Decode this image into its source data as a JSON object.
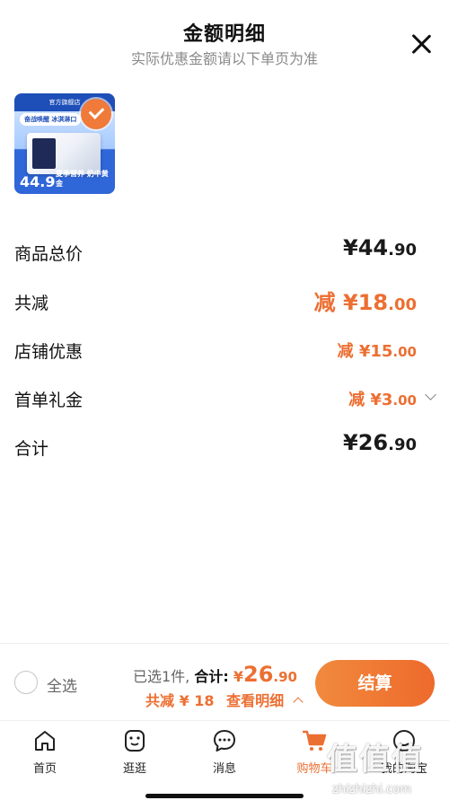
{
  "header": {
    "title": "金额明细",
    "subtitle": "实际优惠金额请以下单页为准"
  },
  "product": {
    "thumb_top_text": "官方旗舰店",
    "thumb_tag": "奋战唤醒 冰淇淋口",
    "thumb_price": "44.9",
    "thumb_slogan": "夏季营养 奶中黄金",
    "selected": true
  },
  "breakdown": [
    {
      "label": "商品总价",
      "prefix": "",
      "yen": "¥",
      "whole": "44",
      "cents": ".90"
    },
    {
      "label": "共减",
      "prefix": "减 ",
      "yen": "¥",
      "whole": "18",
      "cents": ".00"
    },
    {
      "label": "店铺优惠",
      "prefix": "减 ",
      "yen": "¥",
      "whole": "15",
      "cents": ".00"
    },
    {
      "label": "首单礼金",
      "prefix": "减 ",
      "yen": "¥",
      "whole": "3",
      "cents": ".00"
    },
    {
      "label": "合计",
      "prefix": "",
      "yen": "¥",
      "whole": "26",
      "cents": ".90"
    }
  ],
  "bottom_bar": {
    "select_all_label": "全选",
    "selected_count_text": "已选1件,",
    "total_label": "合计:",
    "total_yen": "¥",
    "total_whole": "26",
    "total_cents": ".90",
    "discount_text": "共减 ¥ 18",
    "view_detail_text": "查看明细",
    "checkout_label": "结算"
  },
  "tabbar": {
    "tabs": [
      {
        "label": "首页",
        "icon": "home-icon"
      },
      {
        "label": "逛逛",
        "icon": "guang-icon"
      },
      {
        "label": "消息",
        "icon": "message-icon"
      },
      {
        "label": "购物车",
        "icon": "cart-icon"
      },
      {
        "label": "我的淘宝",
        "icon": "profile-icon"
      }
    ],
    "active_index": 3
  },
  "watermark": {
    "logo": "值值值",
    "url": "zhizhizhi.com"
  },
  "colors": {
    "accent": "#ec6f32",
    "text": "#111111",
    "muted": "#8a8a8a"
  }
}
